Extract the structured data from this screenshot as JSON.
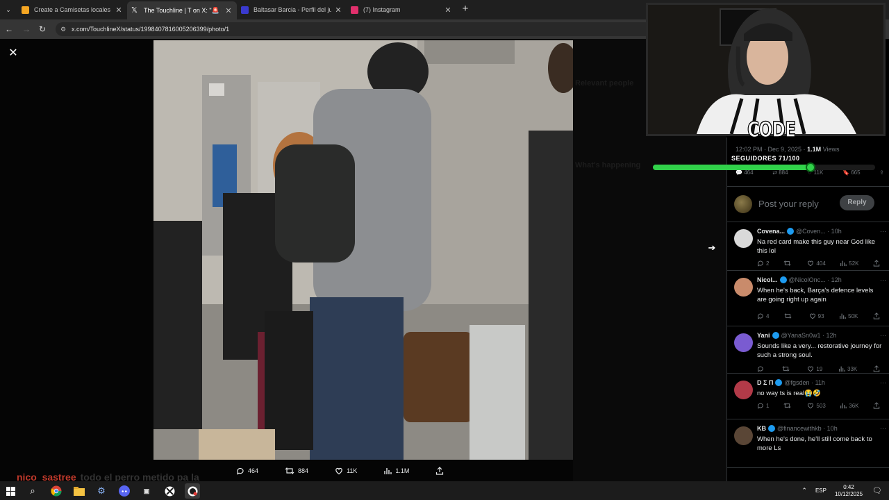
{
  "browser": {
    "tabs": [
      {
        "title": "Create a Camisetas locales de F",
        "icon_color": "#f5a623",
        "active": false
      },
      {
        "title": "The Touchline | T on X: \"🚨 NEW",
        "icon_color": "#ffffff",
        "active": true
      },
      {
        "title": "Baltasar Barcia - Perfil del jugador",
        "icon_color": "#3a3acf",
        "active": false
      },
      {
        "title": "(7) Instagram",
        "icon_color": "#e1306c",
        "active": false
      }
    ],
    "url": "x.com/TouchlineX/status/1998407816005206399/photo/1"
  },
  "viewer": {
    "actions": [
      {
        "icon": "reply-icon",
        "count": "464"
      },
      {
        "icon": "retweet-icon",
        "count": "884"
      },
      {
        "icon": "like-icon",
        "count": "11K"
      },
      {
        "icon": "views-icon",
        "count": "1.1M"
      },
      {
        "icon": "share-icon",
        "count": ""
      }
    ]
  },
  "sidebar_ghost": {
    "relevant_people": "Relevant people",
    "whats_happening": "What's happening"
  },
  "post": {
    "time": "12:02 PM · Dec 9, 2025 ·",
    "views_count": "1.1M",
    "views_label": "Views",
    "stats": {
      "replies": "464",
      "reposts": "884",
      "likes": "11K",
      "bookmarks": "665"
    },
    "reply_placeholder": "Post your reply",
    "reply_button": "Reply"
  },
  "replies": [
    {
      "name": "Covena...",
      "handle": "@Coven...",
      "time": "· 10h",
      "text": "Na red card make this guy near God like this lol",
      "replies": "2",
      "reposts": "",
      "likes": "404",
      "views": "52K",
      "avatar_color": "#d9d9d9"
    },
    {
      "name": "Nicol...",
      "handle": "@NicolOnc...",
      "time": "· 12h",
      "text": "When he's back, Barça's defence levels are going right up again",
      "replies": "4",
      "reposts": "",
      "likes": "93",
      "views": "50K",
      "avatar_color": "#c98b6b"
    },
    {
      "name": "Yani",
      "handle": "@YanaSn0w1",
      "time": "· 12h",
      "text": "Sounds like a very... restorative journey for such a strong soul.",
      "replies": "",
      "reposts": "",
      "likes": "19",
      "views": "33K",
      "avatar_color": "#7a5bd1"
    },
    {
      "name": "D Σ Π",
      "handle": "@fgsden",
      "time": "· 11h",
      "text": "no way ts is real😭🤣",
      "replies": "1",
      "reposts": "",
      "likes": "503",
      "views": "36K",
      "avatar_color": "#b23a48"
    },
    {
      "name": "KB",
      "handle": "@financewithkb",
      "time": "· 10h",
      "text": "When he's done, he'll still come back to more Ls",
      "replies": "",
      "reposts": "",
      "likes": "",
      "views": "",
      "avatar_color": "#5a4636"
    }
  ],
  "overlay": {
    "code_label": "CODE",
    "followers_label": "SEGUIDORES 71/100",
    "followers_progress": 0.71,
    "progress_color": "#31d24a"
  },
  "chat": {
    "user": "nico_sastree",
    "message": "todo el perro metido pa la"
  },
  "taskbar": {
    "language": "ESP",
    "time": "0:42",
    "date": "10/12/2025"
  }
}
